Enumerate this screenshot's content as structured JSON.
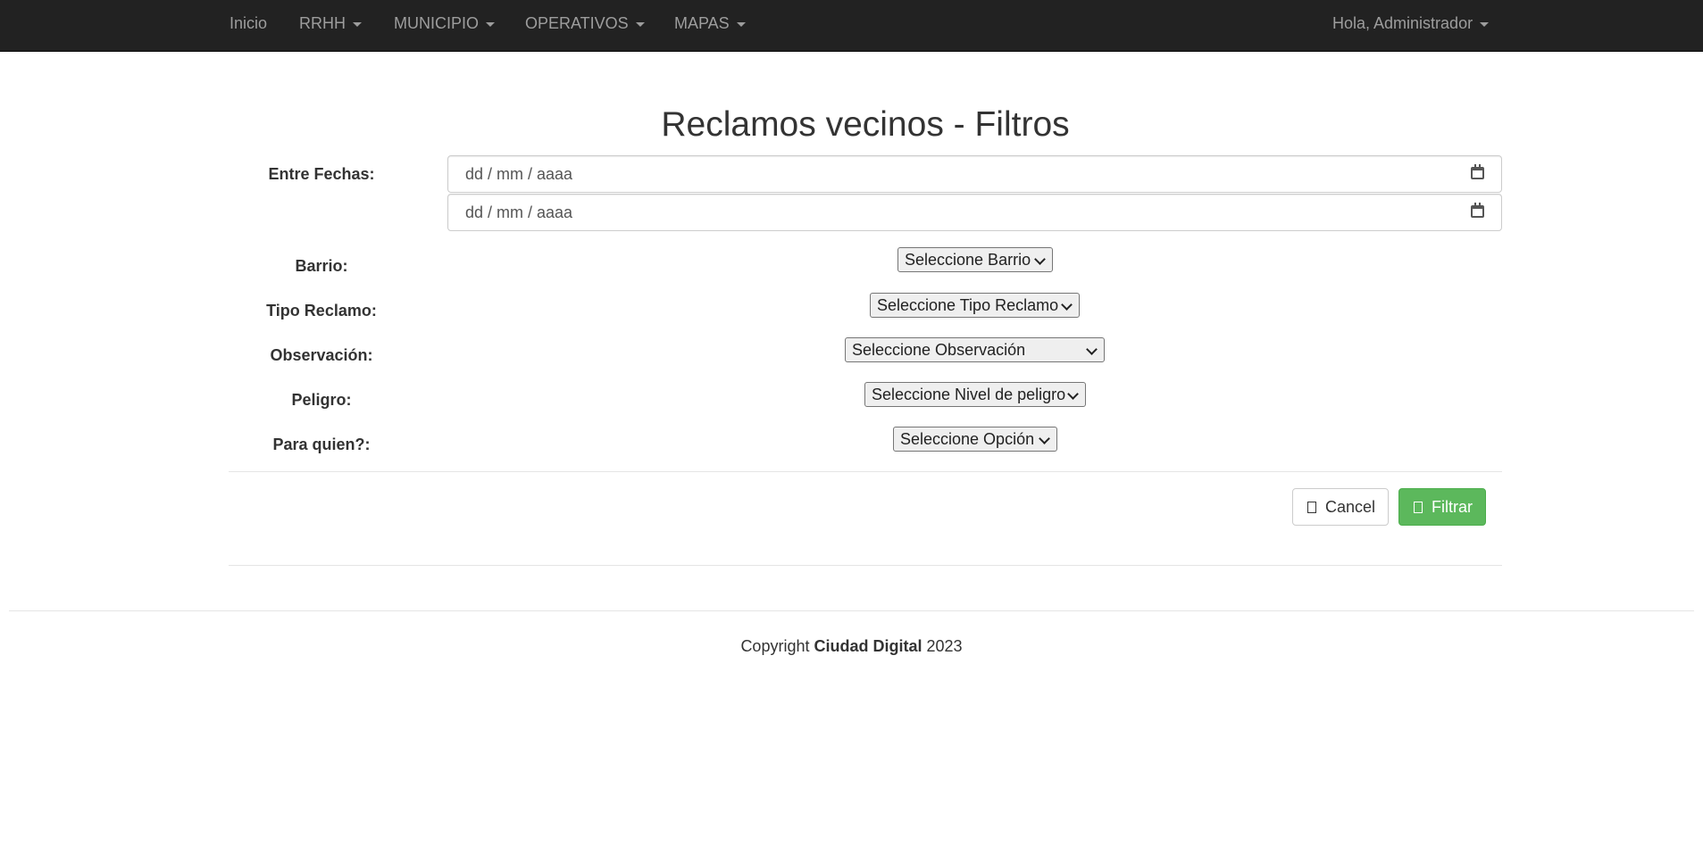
{
  "navbar": {
    "items": [
      {
        "label": "Inicio",
        "dropdown": false
      },
      {
        "label": "RRHH",
        "dropdown": true
      },
      {
        "label": "MUNICIPIO",
        "dropdown": true
      },
      {
        "label": "OPERATIVOS",
        "dropdown": true
      },
      {
        "label": "MAPAS",
        "dropdown": true
      }
    ],
    "user_menu": "Hola, Administrador"
  },
  "page": {
    "title": "Reclamos vecinos - Filtros"
  },
  "form": {
    "dates_label": "Entre Fechas:",
    "date_from_placeholder": "dd / mm / aaaa",
    "date_to_placeholder": "dd / mm / aaaa",
    "barrio_label": "Barrio:",
    "barrio_selected": "Seleccione Barrio",
    "tipo_label": "Tipo Reclamo:",
    "tipo_selected": "Seleccione Tipo Reclamo",
    "observacion_label": "Observación:",
    "observacion_selected": "Seleccione Observación",
    "peligro_label": "Peligro:",
    "peligro_selected": "Seleccione Nivel de peligro",
    "para_quien_label": "Para quien?:",
    "para_quien_selected": "Seleccione Opción"
  },
  "buttons": {
    "cancel": "Cancel",
    "filter": "Filtrar"
  },
  "footer": {
    "prefix": "Copyright",
    "brand": "Ciudad Digital",
    "year": "2023"
  },
  "colors": {
    "navbar_bg": "#222222",
    "nav_text": "#9d9d9d",
    "filter_button": "#5cb85c"
  }
}
